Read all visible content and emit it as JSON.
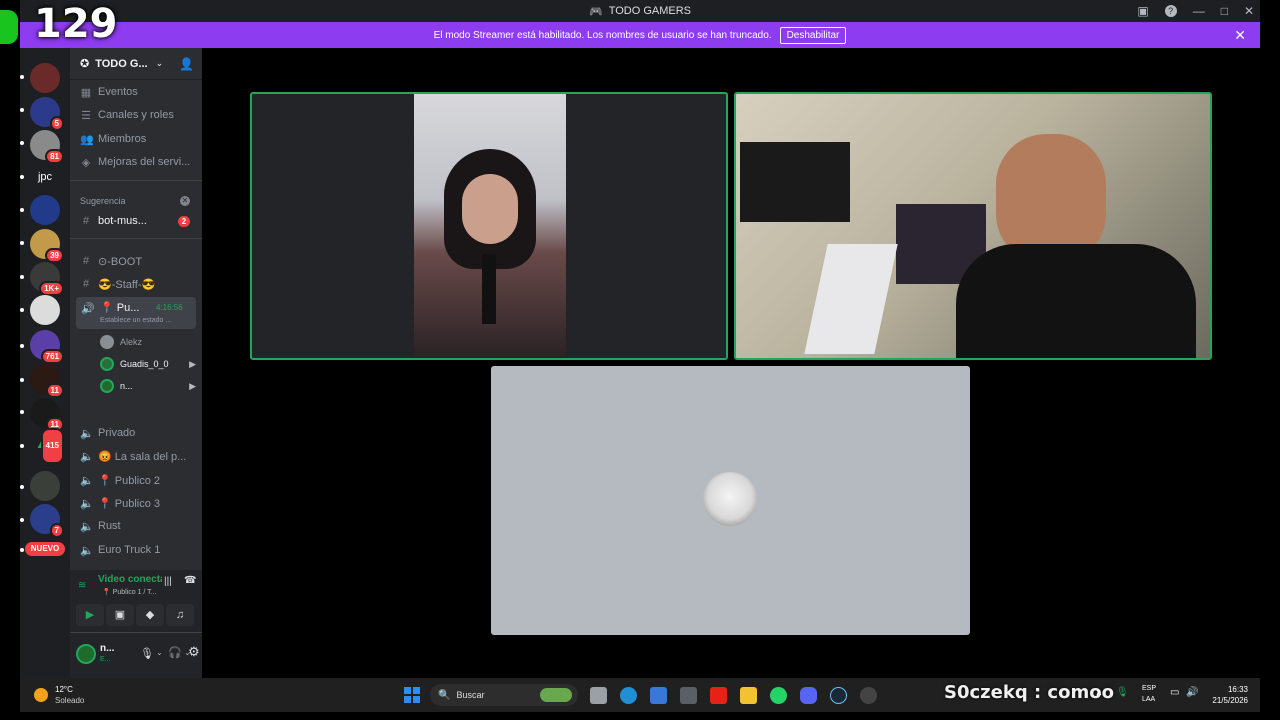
{
  "overlay": {
    "counter": "129"
  },
  "window": {
    "title": "TODO GAMERS"
  },
  "banner": {
    "text": "El modo Streamer está habilitado. Los nombres de usuario se han truncado.",
    "button": "Deshabilitar"
  },
  "servers": {
    "badges": [
      "5",
      "81",
      "39",
      "1K+",
      "761",
      "11",
      "11",
      "415",
      "7"
    ],
    "text_server": "jpc",
    "nuevo": "NUEVO"
  },
  "sidebar": {
    "server_name": "TODO G...",
    "menu": [
      "Eventos",
      "Canales y roles",
      "Miembros",
      "Mejoras del servi..."
    ],
    "suggestion_label": "Sugerencia",
    "suggested_channel": "bot-mus...",
    "suggested_count": "2",
    "channels": {
      "boot": "⊙-BOOT",
      "staff": "😎-Staff-😎",
      "voice_active": "📍 Pu...",
      "voice_active_time": "4:16:56",
      "voice_status": "Establece un estado ...",
      "members": [
        "Alekz",
        "Guadis_0_0",
        "n..."
      ],
      "privado": "Privado",
      "sala": "😡 La sala del p...",
      "publico2": "📍 Publico 2",
      "publico3": "📍 Publico 3",
      "rust": "Rust",
      "euro": "Euro Truck 1"
    },
    "voice": {
      "status": "Video conectad",
      "channel": "📍 Publico 1 / T..."
    },
    "user": {
      "name": "n...",
      "sub": "E..."
    }
  },
  "taskbar": {
    "weather_temp": "12°C",
    "weather_desc": "Soleado",
    "search": "Buscar",
    "overlay_text": "S0czekq : comoo",
    "lang_top": "ESP",
    "lang_bottom": "LAA",
    "time": "16:33",
    "date": "21/5/2026"
  },
  "colors": {
    "accent": "#8d3cf0",
    "speaking": "#23a55a",
    "danger": "#f23f43"
  }
}
